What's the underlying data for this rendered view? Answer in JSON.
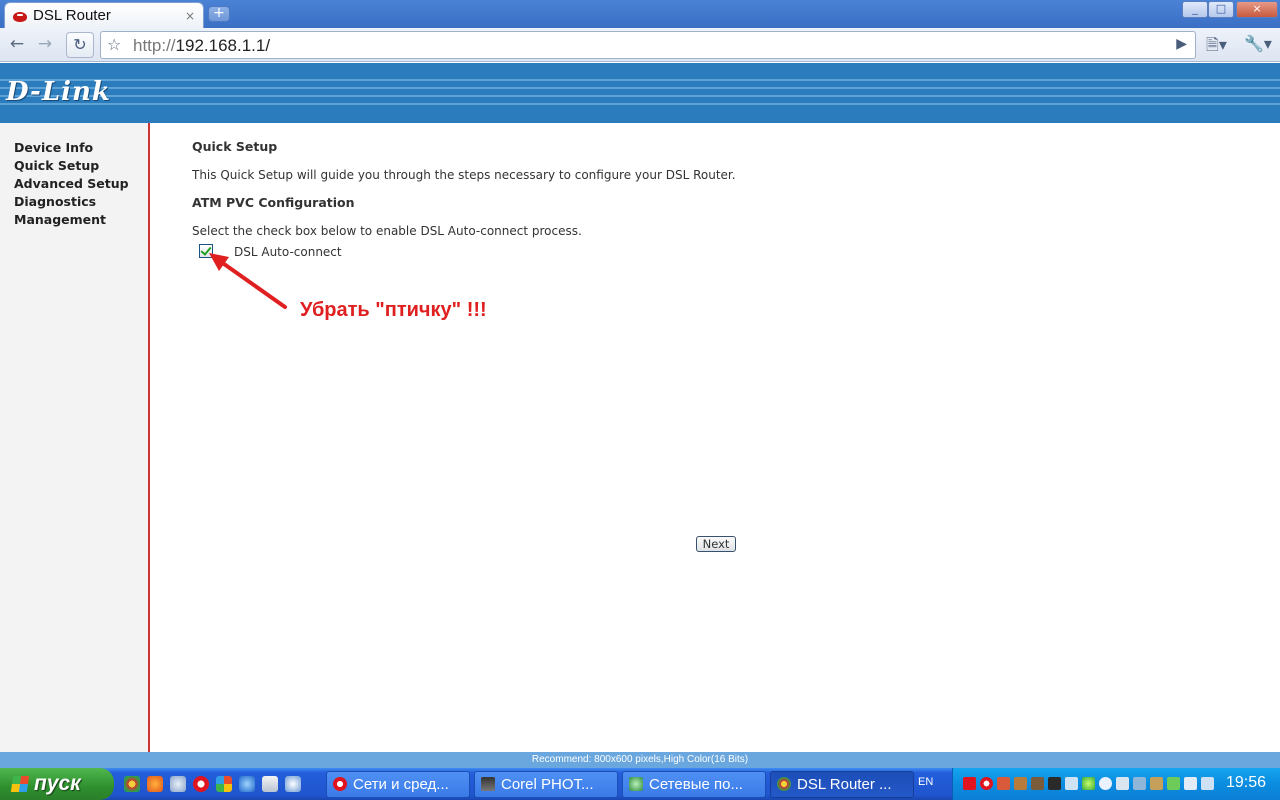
{
  "browser": {
    "tab_title": "DSL Router",
    "tab_close": "×",
    "new_tab": "+",
    "url_scheme": "http://",
    "url_host": "192.168.1.1/",
    "window_controls": {
      "minimize": "_",
      "maximize": "□",
      "close": "×"
    }
  },
  "banner": {
    "logo": "D-Link"
  },
  "sidebar": {
    "items": [
      {
        "label": "Device Info"
      },
      {
        "label": "Quick Setup"
      },
      {
        "label": "Advanced Setup"
      },
      {
        "label": "Diagnostics"
      },
      {
        "label": "Management"
      }
    ]
  },
  "main": {
    "title": "Quick Setup",
    "intro": "This Quick Setup will guide you through the steps necessary to configure your DSL Router.",
    "section_title": "ATM PVC Configuration",
    "instruction": "Select the check box below to enable DSL Auto-connect process.",
    "checkbox_label": "DSL Auto-connect",
    "checkbox_checked": true,
    "annotation": "Убрать \"птичку\" !!!",
    "next_label": "Next"
  },
  "status_bar": {
    "text": "Recommend: 800x600 pixels,High Color(16 Bits)"
  },
  "taskbar": {
    "start_label": "пуск",
    "buttons": [
      {
        "label": "Сети и сред...",
        "icon": "opera-icon"
      },
      {
        "label": "Corel PHOT...",
        "icon": "corel-icon"
      },
      {
        "label": "Сетевые по...",
        "icon": "network-icon"
      },
      {
        "label": "DSL Router ...",
        "icon": "chrome-icon"
      }
    ],
    "language": "EN",
    "clock": "19:56"
  },
  "colors": {
    "banner": "#2a7cbd",
    "sidebar_border": "#cc3333",
    "annotation": "#e02020",
    "checkmark": "#21a121"
  }
}
